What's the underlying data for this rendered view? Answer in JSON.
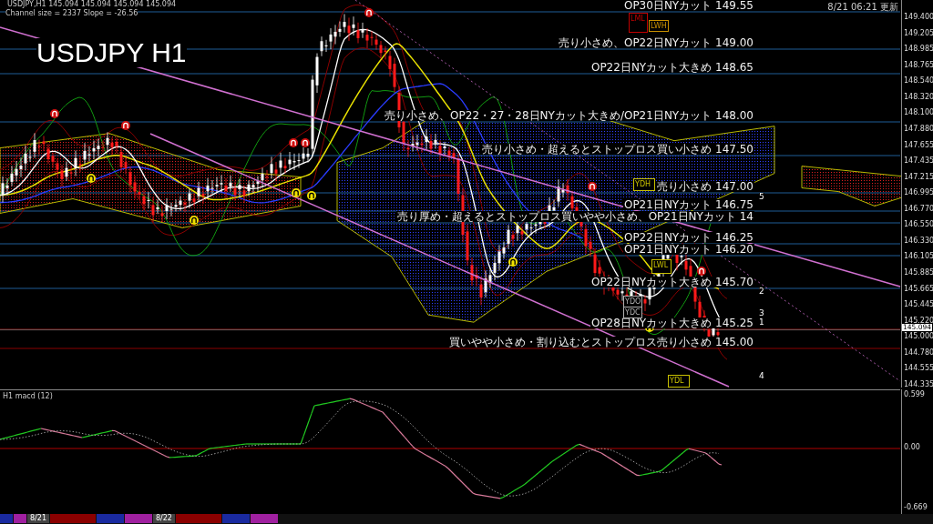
{
  "header": {
    "symbol_line": "USDJPY,H1  145.094 145.094 145.094 145.094",
    "channel_info": "Channel size = 2337 Slope = -26.56",
    "title": "USDJPY H1",
    "updated": "8/21 06:21 更新"
  },
  "annotations": [
    "OP30日NYカット 149.55",
    "売り小さめ、OP22日NYカット 149.00",
    "OP22日NYカット大きめ 148.65",
    "売り小さめ、OP22・27・28日NYカット大きめ/OP21日NYカット 148.00",
    "売り小さめ・超えるとストップロス買い小さめ 147.50",
    "売り小さめ 147.00",
    "OP21日NYカット 146.75",
    "売り厚め・超えるとストップロス買いやや小さめ、OP21日NYカット 14",
    "OP22日NYカット 146.25",
    "OP21日NYカット 146.20",
    "OP22日NYカット大きめ 145.70",
    "OP28日NYカット大きめ 145.25",
    "買いやや小さめ・割り込むとストップロス売り小さめ 145.00"
  ],
  "markers": [
    {
      "text": "LML",
      "color": "#c00000"
    },
    {
      "text": "LWH",
      "color": "#c89000"
    },
    {
      "text": "YDH",
      "color": "#c8c000"
    },
    {
      "text": "LWL",
      "color": "#c8c000"
    },
    {
      "text": "YDO",
      "color": "#b0b0b0"
    },
    {
      "text": "YDC",
      "color": "#b0b0b0"
    },
    {
      "text": "YDL",
      "color": "#c8c000"
    }
  ],
  "wave_labels": [
    "5",
    "2",
    "3",
    "1",
    "4"
  ],
  "price_axis": {
    "ticks": [
      "149.400",
      "149.205",
      "148.985",
      "148.765",
      "148.540",
      "148.320",
      "148.100",
      "147.880",
      "147.655",
      "147.435",
      "147.215",
      "146.995",
      "146.770",
      "146.550",
      "146.330",
      "146.105",
      "145.885",
      "145.665",
      "145.445",
      "145.220",
      "145.000",
      "144.780",
      "144.555",
      "144.335"
    ],
    "current": "145.094"
  },
  "macd": {
    "label": "H1  macd (12)",
    "ticks": [
      "0.599",
      "0.00",
      "-0.669"
    ]
  },
  "timeline": {
    "dates": [
      "8/21",
      "8/22"
    ]
  }
}
